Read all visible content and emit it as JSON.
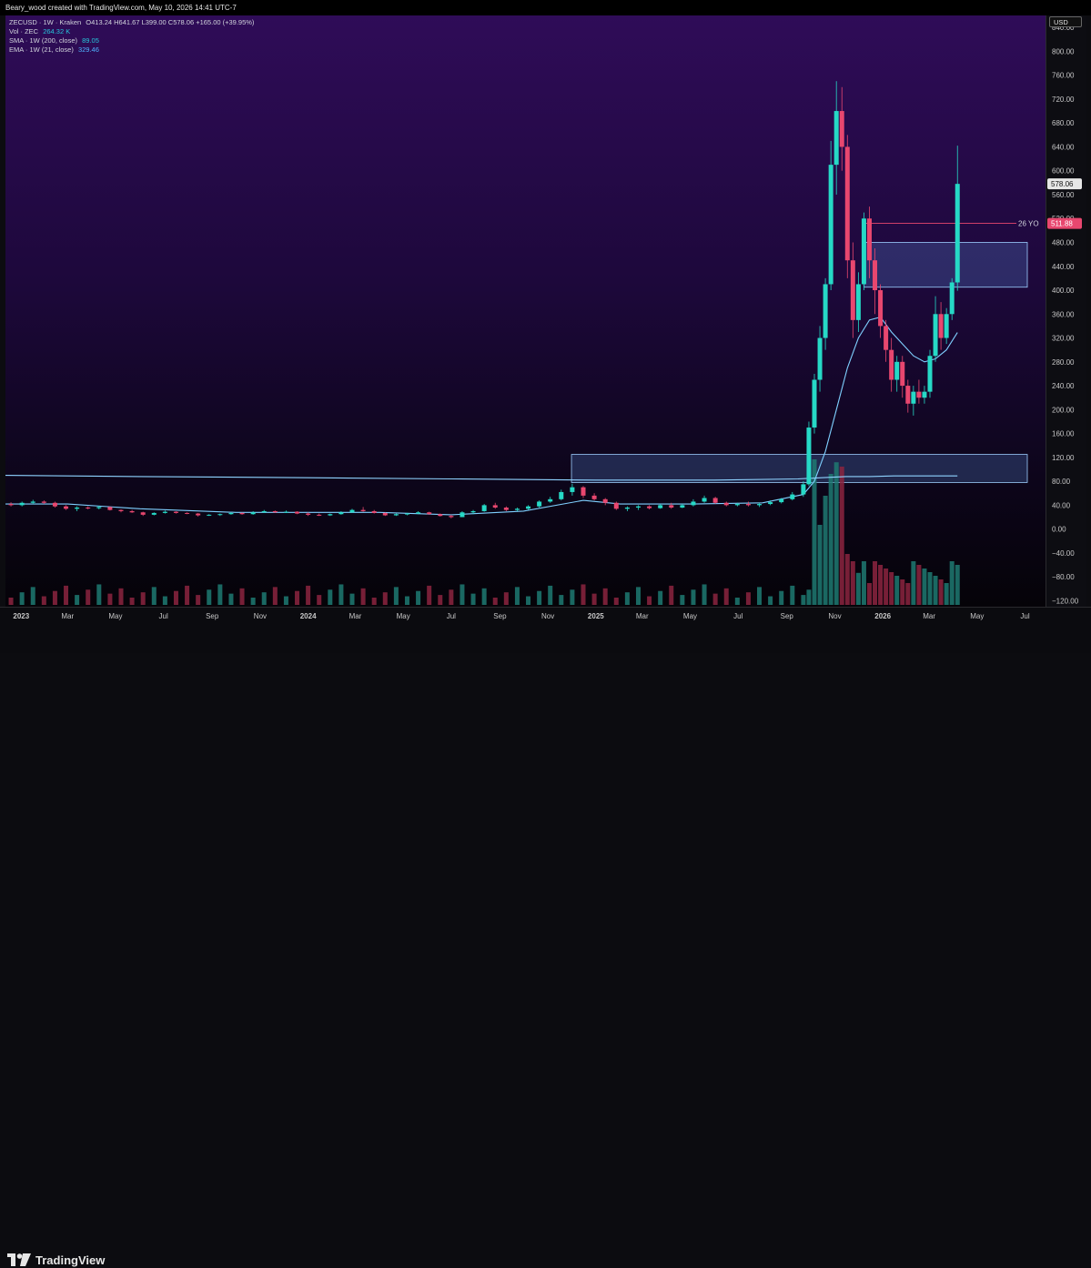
{
  "header": {
    "credit": "Beary_wood created with TradingView.com, May 10, 2026 14:41 UTC-7"
  },
  "legend": {
    "symbol_line": "ZECUSD · 1W · Kraken",
    "ohlc": "O413.24  H641.67  L399.00  C578.06  +165.00 (+39.95%)",
    "vol_label": "Vol · ZEC",
    "vol_value": "264.32 K",
    "sma_label": "SMA · 1W (200, close)",
    "sma_value": "89.05",
    "ema_label": "EMA · 1W (21, close)",
    "ema_value": "329.46"
  },
  "currency": "USD",
  "last_price_label": "578.06",
  "level_label": "511.88",
  "level_tag": "26 YO",
  "footer": {
    "brand": "TradingView"
  },
  "colors": {
    "up": "#26d9c6",
    "down": "#e8476f",
    "vol_up": "#1f7a72",
    "vol_down": "#8c2440",
    "sma": "#8fd3ff",
    "ema": "#7fd0ff",
    "zone_fill": "#6aa8ff",
    "zone_stroke": "#9ecfff",
    "level_line": "#e8476f"
  },
  "chart_data": {
    "type": "candlestick",
    "title": "ZECUSD · 1W · Kraken",
    "xlabel": "",
    "ylabel": "USD",
    "y_ticks": [
      840,
      800,
      760,
      720,
      680,
      640,
      600,
      560,
      520,
      480,
      440,
      400,
      360,
      320,
      280,
      240,
      200,
      160,
      120,
      80,
      40,
      0,
      -40,
      -80,
      -120
    ],
    "x_ticks": [
      "2023",
      "Mar",
      "May",
      "Jul",
      "Sep",
      "Nov",
      "2024",
      "Mar",
      "May",
      "Jul",
      "Sep",
      "Nov",
      "2025",
      "Mar",
      "May",
      "Jul",
      "Sep",
      "Nov",
      "2026",
      "Mar",
      "May",
      "Jul"
    ],
    "x_range": [
      "2022-12-12",
      "2026-07-27"
    ],
    "ylim": [
      -130,
      860
    ],
    "candles": [
      [
        "2022-12-19",
        42,
        45,
        38,
        40
      ],
      [
        "2023-01-02",
        40,
        46,
        38,
        44
      ],
      [
        "2023-01-16",
        44,
        49,
        42,
        46
      ],
      [
        "2023-01-30",
        46,
        48,
        42,
        44
      ],
      [
        "2023-02-13",
        44,
        46,
        36,
        38
      ],
      [
        "2023-02-27",
        38,
        40,
        32,
        34
      ],
      [
        "2023-03-13",
        34,
        38,
        30,
        36
      ],
      [
        "2023-03-27",
        36,
        38,
        33,
        35
      ],
      [
        "2023-04-10",
        35,
        39,
        33,
        37
      ],
      [
        "2023-04-24",
        37,
        38,
        31,
        32
      ],
      [
        "2023-05-08",
        32,
        33,
        28,
        30
      ],
      [
        "2023-05-22",
        30,
        32,
        27,
        28
      ],
      [
        "2023-06-05",
        28,
        29,
        22,
        24
      ],
      [
        "2023-06-19",
        24,
        28,
        23,
        27
      ],
      [
        "2023-07-03",
        27,
        31,
        26,
        29
      ],
      [
        "2023-07-17",
        29,
        30,
        26,
        27
      ],
      [
        "2023-07-31",
        27,
        28,
        25,
        26
      ],
      [
        "2023-08-14",
        26,
        27,
        21,
        23
      ],
      [
        "2023-08-28",
        23,
        25,
        22,
        24
      ],
      [
        "2023-09-11",
        24,
        26,
        22,
        25
      ],
      [
        "2023-09-25",
        25,
        28,
        24,
        27
      ],
      [
        "2023-10-09",
        27,
        28,
        24,
        25
      ],
      [
        "2023-10-23",
        25,
        30,
        24,
        28
      ],
      [
        "2023-11-06",
        28,
        32,
        27,
        30
      ],
      [
        "2023-11-20",
        30,
        31,
        27,
        28
      ],
      [
        "2023-12-04",
        28,
        31,
        27,
        29
      ],
      [
        "2023-12-18",
        29,
        30,
        25,
        26
      ],
      [
        "2024-01-01",
        26,
        28,
        22,
        24
      ],
      [
        "2024-01-15",
        24,
        26,
        22,
        23
      ],
      [
        "2024-01-29",
        23,
        26,
        22,
        25
      ],
      [
        "2024-02-12",
        25,
        30,
        24,
        28
      ],
      [
        "2024-02-26",
        28,
        34,
        27,
        32
      ],
      [
        "2024-03-11",
        32,
        37,
        29,
        30
      ],
      [
        "2024-03-25",
        30,
        32,
        26,
        27
      ],
      [
        "2024-04-08",
        27,
        28,
        22,
        23
      ],
      [
        "2024-04-22",
        23,
        26,
        22,
        25
      ],
      [
        "2024-05-06",
        25,
        27,
        23,
        26
      ],
      [
        "2024-05-20",
        26,
        30,
        25,
        28
      ],
      [
        "2024-06-03",
        28,
        29,
        24,
        25
      ],
      [
        "2024-06-17",
        25,
        26,
        21,
        22
      ],
      [
        "2024-07-01",
        22,
        24,
        18,
        20
      ],
      [
        "2024-07-15",
        20,
        30,
        20,
        28
      ],
      [
        "2024-07-29",
        28,
        32,
        25,
        30
      ],
      [
        "2024-08-12",
        30,
        42,
        29,
        40
      ],
      [
        "2024-08-26",
        40,
        44,
        34,
        36
      ],
      [
        "2024-09-09",
        36,
        38,
        30,
        32
      ],
      [
        "2024-09-23",
        32,
        36,
        30,
        34
      ],
      [
        "2024-10-07",
        34,
        40,
        32,
        38
      ],
      [
        "2024-10-21",
        38,
        48,
        36,
        46
      ],
      [
        "2024-11-04",
        46,
        54,
        44,
        50
      ],
      [
        "2024-11-18",
        50,
        66,
        48,
        62
      ],
      [
        "2024-12-02",
        62,
        76,
        56,
        70
      ],
      [
        "2024-12-16",
        70,
        72,
        52,
        56
      ],
      [
        "2024-12-30",
        56,
        60,
        48,
        50
      ],
      [
        "2025-01-13",
        50,
        52,
        40,
        44
      ],
      [
        "2025-01-27",
        44,
        46,
        32,
        34
      ],
      [
        "2025-02-10",
        34,
        38,
        30,
        36
      ],
      [
        "2025-02-24",
        36,
        40,
        32,
        38
      ],
      [
        "2025-03-10",
        38,
        40,
        33,
        35
      ],
      [
        "2025-03-24",
        35,
        42,
        34,
        40
      ],
      [
        "2025-04-07",
        40,
        44,
        34,
        36
      ],
      [
        "2025-04-21",
        36,
        42,
        35,
        40
      ],
      [
        "2025-05-05",
        40,
        50,
        38,
        46
      ],
      [
        "2025-05-19",
        46,
        56,
        44,
        52
      ],
      [
        "2025-06-02",
        52,
        54,
        42,
        44
      ],
      [
        "2025-06-16",
        44,
        46,
        38,
        40
      ],
      [
        "2025-06-30",
        40,
        44,
        38,
        42
      ],
      [
        "2025-07-14",
        42,
        46,
        38,
        40
      ],
      [
        "2025-07-28",
        40,
        44,
        37,
        42
      ],
      [
        "2025-08-11",
        42,
        48,
        40,
        45
      ],
      [
        "2025-08-25",
        45,
        52,
        43,
        50
      ],
      [
        "2025-09-08",
        50,
        62,
        48,
        58
      ],
      [
        "2025-09-22",
        58,
        80,
        54,
        75
      ],
      [
        "2025-09-29",
        75,
        180,
        72,
        170
      ],
      [
        "2025-10-06",
        170,
        260,
        160,
        250
      ],
      [
        "2025-10-13",
        250,
        340,
        230,
        320
      ],
      [
        "2025-10-20",
        320,
        420,
        300,
        410
      ],
      [
        "2025-10-27",
        410,
        650,
        400,
        610
      ],
      [
        "2025-11-03",
        610,
        750,
        560,
        700
      ],
      [
        "2025-11-10",
        700,
        740,
        600,
        640
      ],
      [
        "2025-11-17",
        640,
        660,
        420,
        450
      ],
      [
        "2025-11-24",
        450,
        480,
        320,
        350
      ],
      [
        "2025-12-01",
        350,
        430,
        330,
        410
      ],
      [
        "2025-12-08",
        410,
        530,
        400,
        520
      ],
      [
        "2025-12-15",
        520,
        540,
        420,
        450
      ],
      [
        "2025-12-22",
        450,
        470,
        360,
        400
      ],
      [
        "2025-12-29",
        400,
        410,
        320,
        340
      ],
      [
        "2026-01-05",
        340,
        350,
        280,
        300
      ],
      [
        "2026-01-12",
        300,
        320,
        230,
        250
      ],
      [
        "2026-01-19",
        250,
        290,
        230,
        280
      ],
      [
        "2026-01-26",
        280,
        290,
        220,
        240
      ],
      [
        "2026-02-02",
        240,
        250,
        195,
        210
      ],
      [
        "2026-02-09",
        210,
        240,
        190,
        230
      ],
      [
        "2026-02-16",
        230,
        250,
        210,
        220
      ],
      [
        "2026-02-23",
        220,
        240,
        210,
        230
      ],
      [
        "2026-03-02",
        230,
        300,
        220,
        290
      ],
      [
        "2026-03-09",
        290,
        390,
        280,
        360
      ],
      [
        "2026-03-16",
        360,
        380,
        300,
        320
      ],
      [
        "2026-03-23",
        320,
        370,
        310,
        360
      ],
      [
        "2026-03-30",
        360,
        420,
        350,
        413
      ],
      [
        "2026-04-06",
        413,
        642,
        399,
        578
      ]
    ],
    "sma_200": {
      "name": "SMA · 1W (200, close)",
      "x": [
        "2022-12-12",
        "2023-06-01",
        "2024-01-01",
        "2024-07-01",
        "2025-01-01",
        "2025-06-01",
        "2025-09-15",
        "2025-10-15",
        "2025-11-15",
        "2025-12-15",
        "2026-01-15",
        "2026-02-15",
        "2026-03-15",
        "2026-04-06"
      ],
      "y": [
        90,
        88,
        86,
        84,
        82,
        82,
        84,
        86,
        88,
        88,
        89,
        89,
        89,
        89
      ]
    },
    "ema_21": {
      "name": "EMA · 1W (21, close)",
      "x": [
        "2022-12-12",
        "2023-03-01",
        "2023-06-01",
        "2023-10-01",
        "2024-01-01",
        "2024-04-01",
        "2024-07-01",
        "2024-10-01",
        "2024-12-16",
        "2025-02-01",
        "2025-05-01",
        "2025-08-01",
        "2025-09-22",
        "2025-10-06",
        "2025-10-20",
        "2025-11-03",
        "2025-11-17",
        "2025-12-01",
        "2025-12-15",
        "2025-12-29",
        "2026-01-12",
        "2026-01-26",
        "2026-02-09",
        "2026-02-23",
        "2026-03-09",
        "2026-03-23",
        "2026-04-06"
      ],
      "y": [
        42,
        42,
        34,
        28,
        28,
        28,
        24,
        30,
        48,
        42,
        42,
        44,
        58,
        80,
        130,
        200,
        270,
        320,
        350,
        355,
        330,
        310,
        290,
        280,
        285,
        300,
        329
      ]
    },
    "volume": {
      "note": "relative weekly volume, 0-1 scale",
      "values_up_down_pattern": "up when close >= open"
    },
    "annotations": [
      {
        "type": "horizontal-ray",
        "from": "2025-12-08",
        "value": 511.88,
        "label": "26 YO"
      },
      {
        "type": "zone",
        "from": "2025-12-08",
        "to": "2026-07-27",
        "low": 405,
        "high": 480
      },
      {
        "type": "zone",
        "from": "2024-12-01",
        "to": "2026-07-27",
        "low": 78,
        "high": 125
      }
    ],
    "last_price": 578.06
  }
}
